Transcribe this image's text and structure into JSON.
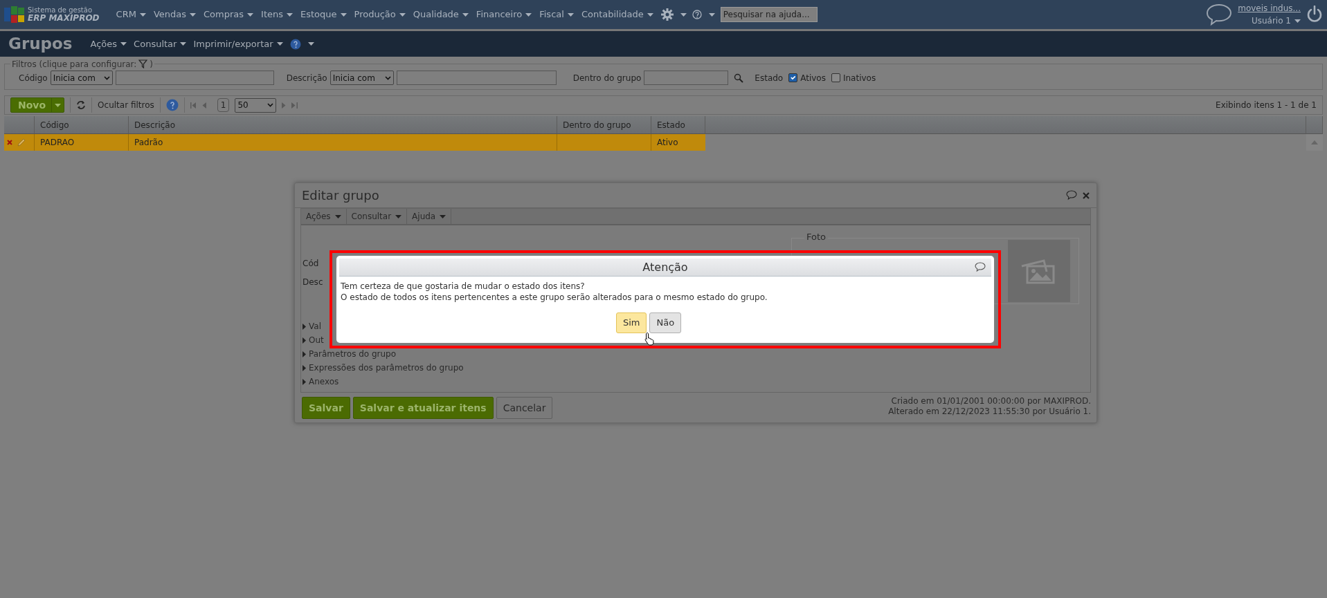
{
  "header": {
    "brand_line1": "Sistema de gestão",
    "brand_line2": "ERP MAXIPROD",
    "menu": [
      "CRM",
      "Vendas",
      "Compras",
      "Itens",
      "Estoque",
      "Produção",
      "Qualidade",
      "Financeiro",
      "Fiscal",
      "Contabilidade"
    ],
    "search_placeholder": "Pesquisar na ajuda...",
    "company": "moveis indus...",
    "user": "Usuário 1"
  },
  "page": {
    "title": "Grupos",
    "menu": [
      "Ações",
      "Consultar",
      "Imprimir/exportar"
    ]
  },
  "filters": {
    "legend": "Filtros (clique para configurar:",
    "legend_end": ")",
    "codigo_label": "Código",
    "codigo_mode": "Inicia com",
    "descricao_label": "Descrição",
    "descricao_mode": "Inicia com",
    "grupo_label": "Dentro do grupo",
    "estado_label": "Estado",
    "states": [
      {
        "label": "Ativos",
        "checked": true
      },
      {
        "label": "Inativos",
        "checked": false
      }
    ]
  },
  "toolbar": {
    "new_button": "Novo",
    "hide_filters": "Ocultar filtros",
    "page": "1",
    "page_size": "50",
    "summary": "Exibindo itens 1 - 1 de 1"
  },
  "table": {
    "columns": [
      "Código",
      "Descrição",
      "Dentro do grupo",
      "Estado"
    ],
    "rows": [
      {
        "codigo": "PADRAO",
        "descricao": "Padrão",
        "estado": "Ativo",
        "selected": true
      }
    ]
  },
  "edit_dialog": {
    "title": "Editar grupo",
    "menu": [
      "Ações",
      "Consultar",
      "Ajuda"
    ],
    "labels": [
      "Cód",
      "Desc"
    ],
    "sections": [
      "Val",
      "Out",
      "Parâmetros do grupo",
      "Expressões dos parâmetros do grupo",
      "Anexos"
    ],
    "photo_legend": "Foto",
    "buttons": [
      {
        "label": "Salvar",
        "kind": "primary"
      },
      {
        "label": "Salvar e atualizar itens",
        "kind": "primary"
      },
      {
        "label": "Cancelar",
        "kind": "secondary"
      }
    ],
    "created": "Criado em 01/01/2001 00:00:00 por MAXIPROD.",
    "altered": "Alterado em 22/12/2023 11:55:30 por Usuário 1."
  },
  "alert": {
    "title": "Atenção",
    "lines": [
      "Tem certeza de que gostaria de mudar o estado dos itens?",
      "O estado de todos os itens pertencentes a este grupo serão alterados para o mesmo estado do grupo."
    ],
    "buttons": [
      {
        "label": "Sim",
        "selected": true
      },
      {
        "label": "Não",
        "selected": false
      }
    ]
  }
}
